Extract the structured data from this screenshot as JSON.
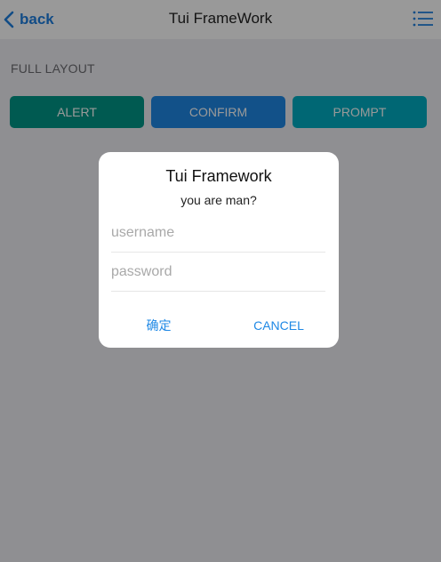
{
  "navbar": {
    "back_label": "back",
    "title": "Tui FrameWork",
    "back_icon": "chevron-left-icon",
    "menu_icon": "list-icon"
  },
  "main": {
    "section_label": "FULL LAYOUT",
    "buttons": {
      "alert": "ALERT",
      "confirm": "CONFIRM",
      "prompt": "PROMPT"
    }
  },
  "dialog": {
    "title": "Tui Framework",
    "message": "you are man?",
    "username_placeholder": "username",
    "password_placeholder": "password",
    "ok_label": "确定",
    "cancel_label": "CANCEL"
  },
  "colors": {
    "accent": "#1e88e5",
    "alert": "#009688",
    "confirm": "#1e88e5",
    "prompt": "#00acc1"
  }
}
